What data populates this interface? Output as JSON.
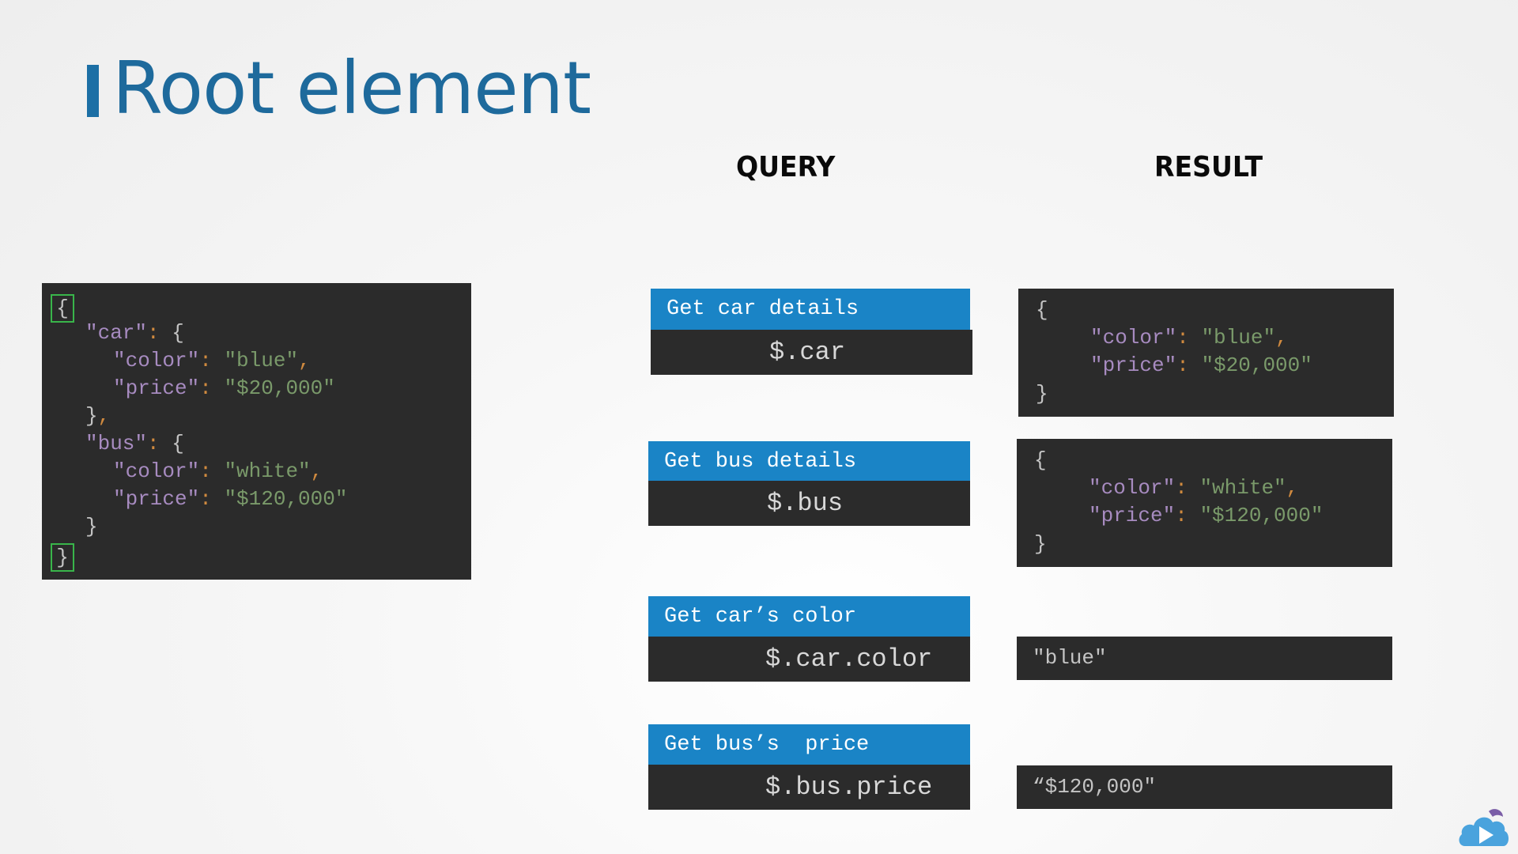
{
  "slide": {
    "title": "Root element",
    "query_header": "QUERY",
    "result_header": "RESULT"
  },
  "json_doc": {
    "open_brace": "{",
    "close_brace": "}",
    "car_key": "\"car\"",
    "car_color_key": "\"color\"",
    "car_color_value": "\"blue\"",
    "car_price_key": "\"price\"",
    "car_price_value": "\"$20,000\"",
    "bus_key": "\"bus\"",
    "bus_color_key": "\"color\"",
    "bus_color_value": "\"white\"",
    "bus_price_key": "\"price\"",
    "bus_price_value": "\"$120,000\""
  },
  "queries": [
    {
      "label": "Get car details",
      "expression": "$.car"
    },
    {
      "label": "Get bus details",
      "expression": "$.bus"
    },
    {
      "label": "Get car’s color",
      "expression": "$.car.color"
    },
    {
      "label": "Get bus’s  price",
      "expression": "$.bus.price"
    }
  ],
  "results": [
    {
      "open": "{",
      "close": "}",
      "color_key": "\"color\"",
      "color_value": "\"blue\"",
      "price_key": "\"price\"",
      "price_value": "\"$20,000\""
    },
    {
      "open": "{",
      "close": "}",
      "color_key": "\"color\"",
      "color_value": "\"white\"",
      "price_key": "\"price\"",
      "price_value": "\"$120,000\""
    },
    {
      "value": "\"blue\""
    },
    {
      "value": "“$120,000\""
    }
  ],
  "colors": {
    "title": "#1e6a9c",
    "query_label_bg": "#1a84c6",
    "code_bg": "#2b2b2b",
    "json_key": "#a78bc0",
    "json_value": "#7a9a6a",
    "punctuation": "#d08a3f",
    "root_highlight": "#39b54a"
  },
  "logo_icon": "cloud-play-logo"
}
